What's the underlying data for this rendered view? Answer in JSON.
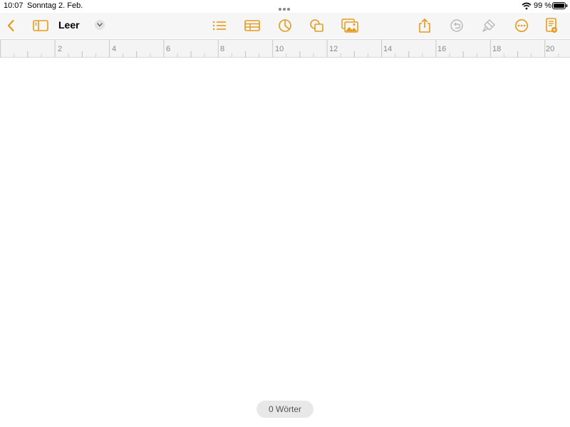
{
  "status_bar": {
    "time": "10:07",
    "date": "Sonntag 2. Feb.",
    "battery_percent": "99 %",
    "wifi_icon": "wifi-icon",
    "battery_icon": "battery-icon",
    "multitask_icon": "ellipsis-dots-icon"
  },
  "toolbar": {
    "document_title": "Leer",
    "accent_color": "#e59b1c",
    "disabled_color": "#b8b8b8",
    "icons": {
      "back": "chevron-left-icon",
      "sidebar": "sidebar-icon",
      "title_menu": "chevron-down-icon",
      "list": "list-icon",
      "table": "table-icon",
      "chart": "chart-icon",
      "shapes": "shapes-icon",
      "media": "media-icon",
      "share": "share-icon",
      "undo": "undo-icon",
      "format": "paintbrush-icon",
      "more": "more-icon",
      "document_setup": "document-icon"
    }
  },
  "ruler": {
    "labels": [
      "2",
      "4",
      "6",
      "8",
      "10",
      "12",
      "14",
      "16",
      "18",
      "20"
    ]
  },
  "document": {
    "word_count_label": "0 Wörter"
  }
}
